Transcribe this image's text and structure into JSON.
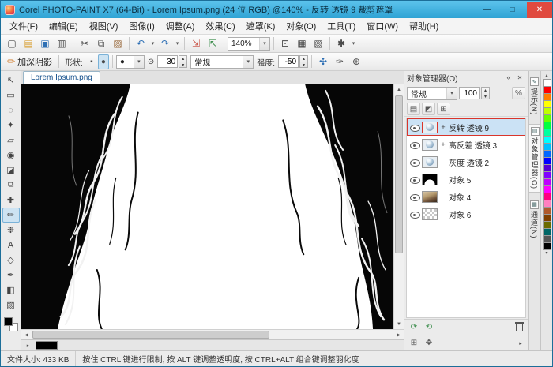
{
  "window": {
    "title": "Corel PHOTO-PAINT X7 (64-Bit) - Lorem Ipsum.png (24 位 RGB) @140% - 反转 透镜 9 裁剪遮罩",
    "controls": {
      "minimize": "—",
      "maximize": "□",
      "close": "✕"
    }
  },
  "menubar": {
    "items": [
      "文件(F)",
      "编辑(E)",
      "视图(V)",
      "图像(I)",
      "调整(A)",
      "效果(C)",
      "遮罩(K)",
      "对象(O)",
      "工具(T)",
      "窗口(W)",
      "帮助(H)"
    ]
  },
  "toolbar": {
    "zoom_value": "140%",
    "icons": [
      {
        "name": "new",
        "glyph": "▢"
      },
      {
        "name": "open",
        "glyph": "▤"
      },
      {
        "name": "save",
        "glyph": "▣"
      },
      {
        "name": "print",
        "glyph": "▥"
      },
      {
        "name": "cut",
        "glyph": "✂"
      },
      {
        "name": "copy",
        "glyph": "⧉"
      },
      {
        "name": "paste",
        "glyph": "▨"
      },
      {
        "name": "undo",
        "glyph": "↶"
      },
      {
        "name": "redo",
        "glyph": "↷"
      },
      {
        "name": "import",
        "glyph": "⇲"
      },
      {
        "name": "export",
        "glyph": "⇱"
      },
      {
        "name": "fullscreen-preview",
        "glyph": "⊡"
      },
      {
        "name": "show-mask-marquee",
        "glyph": "▦"
      },
      {
        "name": "show-object-marquee",
        "glyph": "▧"
      },
      {
        "name": "options",
        "glyph": "✱"
      }
    ]
  },
  "propbar": {
    "preset_glyph": "✏",
    "preset_label": "加深阴影",
    "shape_label": "形状:",
    "nib_square": "▪",
    "nib_round": "●",
    "nib_preview": "●",
    "size_glyph": "⊙",
    "size_value": "30",
    "merge_mode": "常规",
    "strength_label": "强度:",
    "strength_value": "-50",
    "extra_icons": [
      {
        "name": "watercolor-brush",
        "glyph": "✣"
      },
      {
        "name": "pen-pressure",
        "glyph": "✑"
      },
      {
        "name": "brush-options",
        "glyph": "⊕"
      }
    ]
  },
  "toolbox": {
    "tools": [
      {
        "name": "pick",
        "glyph": "↖"
      },
      {
        "name": "mask-rectangle",
        "glyph": "▭"
      },
      {
        "name": "mask-lasso",
        "glyph": "◌"
      },
      {
        "name": "magic-wand",
        "glyph": "✦"
      },
      {
        "name": "crop",
        "glyph": "▱"
      },
      {
        "name": "zoom",
        "glyph": "◉"
      },
      {
        "name": "eraser",
        "glyph": "◪"
      },
      {
        "name": "clone",
        "glyph": "⧉"
      },
      {
        "name": "touch-up",
        "glyph": "✚"
      },
      {
        "name": "effect",
        "glyph": "✏"
      },
      {
        "name": "image-sprayer",
        "glyph": "❉"
      },
      {
        "name": "text",
        "glyph": "A"
      },
      {
        "name": "shape",
        "glyph": "◇"
      },
      {
        "name": "eyedropper",
        "glyph": "✒"
      },
      {
        "name": "fill",
        "glyph": "◧"
      },
      {
        "name": "object-transparency",
        "glyph": "▨"
      }
    ]
  },
  "document": {
    "tab_label": "Lorem Ipsum.png"
  },
  "object_manager": {
    "title": "对象管理器(O)",
    "merge_mode": "常规",
    "opacity_value": "100",
    "expand_glyph": "+",
    "toggles": [
      {
        "name": "paint-on-mask",
        "glyph": "▤"
      },
      {
        "name": "lock-transparency",
        "glyph": "◩"
      },
      {
        "name": "edit-across-objects",
        "glyph": "⊞"
      }
    ],
    "objects": [
      {
        "label": "反转 透镜 9"
      },
      {
        "label": "高反差 透镜 3"
      },
      {
        "label": "灰度 透镜 2"
      },
      {
        "label": "对象 5"
      },
      {
        "label": "对象 4"
      },
      {
        "label": "对象 6"
      }
    ],
    "footer_icons": [
      {
        "name": "new-lens",
        "glyph": "⟳"
      },
      {
        "name": "new-object",
        "glyph": "⟲"
      }
    ],
    "footer_icons2": [
      {
        "name": "thumbnail-options",
        "glyph": "⊞"
      },
      {
        "name": "new-group",
        "glyph": "✥"
      }
    ]
  },
  "right_tabs": [
    {
      "icon": "✎",
      "label": "提示(N)"
    },
    {
      "icon": "▤",
      "label": "对象管理器(O)"
    },
    {
      "icon": "▦",
      "label": "通道(N)"
    }
  ],
  "palette": {
    "colors": [
      "#ffffff",
      "#ff0000",
      "#ff7e00",
      "#ffff00",
      "#bfff00",
      "#66ff00",
      "#00ff40",
      "#00ff9f",
      "#00ffff",
      "#00bfff",
      "#0066ff",
      "#0000ff",
      "#5500d4",
      "#8000ff",
      "#bf00ff",
      "#ff00ff",
      "#ff0080",
      "#ff80c0",
      "#b05a2c",
      "#804000",
      "#6b6b00",
      "#006666",
      "#555555",
      "#000000"
    ]
  },
  "statusbar": {
    "file_size": "文件大小: 433 KB",
    "hint": "按住 CTRL 键进行限制, 按 ALT 键调整透明度, 按 CTRL+ALT 组合键调整羽化度"
  },
  "colors": {
    "titlebar": "#2fa3d4",
    "selection_fill": "#cbe2f5",
    "selection_outline": "#d9352b",
    "close_button": "#e04a3f",
    "canvas_background": "#000000",
    "mask_foreground": "#ffffff"
  }
}
